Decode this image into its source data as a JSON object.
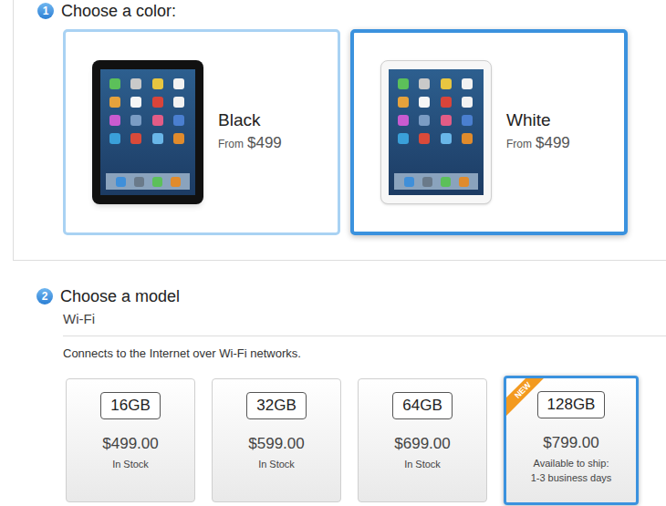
{
  "color_step": {
    "number": "1",
    "title": "Choose a color:",
    "options": [
      {
        "name": "Black",
        "from": "From",
        "price": "$499",
        "selected": false,
        "color": "#111111"
      },
      {
        "name": "White",
        "from": "From",
        "price": "$499",
        "selected": true,
        "color": "#f7f7f7"
      }
    ]
  },
  "model_step": {
    "number": "2",
    "title": "Choose a model",
    "section": "Wi-Fi",
    "description": "Connects to the Internet over Wi-Fi networks.",
    "new_label": "NEW",
    "options": [
      {
        "capacity": "16GB",
        "price": "$499.00",
        "availability": [
          "In Stock"
        ],
        "new": false,
        "selected": false
      },
      {
        "capacity": "32GB",
        "price": "$599.00",
        "availability": [
          "In Stock"
        ],
        "new": false,
        "selected": false
      },
      {
        "capacity": "64GB",
        "price": "$699.00",
        "availability": [
          "In Stock"
        ],
        "new": false,
        "selected": false
      },
      {
        "capacity": "128GB",
        "price": "$799.00",
        "availability": [
          "Available to ship:",
          "1-3 business days"
        ],
        "new": true,
        "selected": true
      }
    ]
  }
}
